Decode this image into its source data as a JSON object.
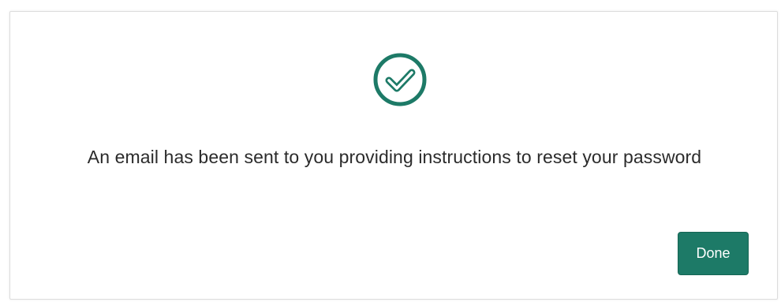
{
  "dialog": {
    "icon": "check-circle-icon",
    "message": "An email has been sent to you providing instructions to reset your password",
    "done_label": "Done"
  },
  "colors": {
    "accent": "#1d7a67",
    "text": "#2b2b2b",
    "border": "#dcdcdc"
  }
}
